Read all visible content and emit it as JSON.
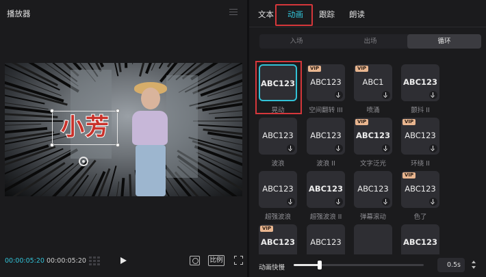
{
  "player": {
    "title": "播放器",
    "caption_text": "小芳",
    "time_current": "00:00:05:20",
    "time_total": "00:00:05:20",
    "ratio_label": "比例"
  },
  "panel": {
    "tabs": [
      {
        "label": "文本",
        "active": false
      },
      {
        "label": "动画",
        "active": true
      },
      {
        "label": "跟踪",
        "active": false
      },
      {
        "label": "朗读",
        "active": false
      }
    ],
    "subtabs": [
      {
        "label": "入场",
        "active": false
      },
      {
        "label": "出场",
        "active": false
      },
      {
        "label": "循环",
        "active": true
      }
    ],
    "effects": [
      {
        "label": "晃动",
        "thumb_text": "ABC123",
        "vip": false,
        "download": false,
        "selected": true
      },
      {
        "label": "空间翻转 III",
        "thumb_text": "ABC123",
        "vip": true,
        "download": true,
        "selected": false
      },
      {
        "label": "喷涌",
        "thumb_text": "ABC1",
        "vip": true,
        "download": true,
        "selected": false
      },
      {
        "label": "颤抖 II",
        "thumb_text": "ABC123",
        "vip": false,
        "download": true,
        "selected": false
      },
      {
        "label": "波浪",
        "thumb_text": "ABC123",
        "vip": false,
        "download": true,
        "selected": false
      },
      {
        "label": "波浪 II",
        "thumb_text": "ABC123",
        "vip": false,
        "download": true,
        "selected": false
      },
      {
        "label": "文字泛光",
        "thumb_text": "ABC123",
        "vip": true,
        "download": true,
        "selected": false
      },
      {
        "label": "环绕 II",
        "thumb_text": "ABC123",
        "vip": true,
        "download": true,
        "selected": false
      },
      {
        "label": "超强波浪",
        "thumb_text": "ABC123",
        "vip": false,
        "download": true,
        "selected": false
      },
      {
        "label": "超强波浪 II",
        "thumb_text": "ABC123",
        "vip": false,
        "download": true,
        "selected": false
      },
      {
        "label": "弹幕滚动",
        "thumb_text": "ABC123",
        "vip": false,
        "download": true,
        "selected": false
      },
      {
        "label": "色了",
        "thumb_text": "ABC123",
        "vip": true,
        "download": true,
        "selected": false
      },
      {
        "label": "",
        "thumb_text": "ABC123",
        "vip": true,
        "download": false,
        "selected": false
      },
      {
        "label": "",
        "thumb_text": "ABC123",
        "vip": false,
        "download": false,
        "selected": false
      },
      {
        "label": "",
        "thumb_text": "",
        "vip": false,
        "download": false,
        "selected": false
      },
      {
        "label": "",
        "thumb_text": "ABC123",
        "vip": false,
        "download": false,
        "selected": false
      }
    ],
    "vip_label": "VIP",
    "speed_label": "动画快慢",
    "speed_value": "0.5s",
    "speed_fraction": 0.2
  },
  "colors": {
    "accent": "#32c3d8",
    "highlight": "#d6373b",
    "vip": "#e9b690"
  }
}
